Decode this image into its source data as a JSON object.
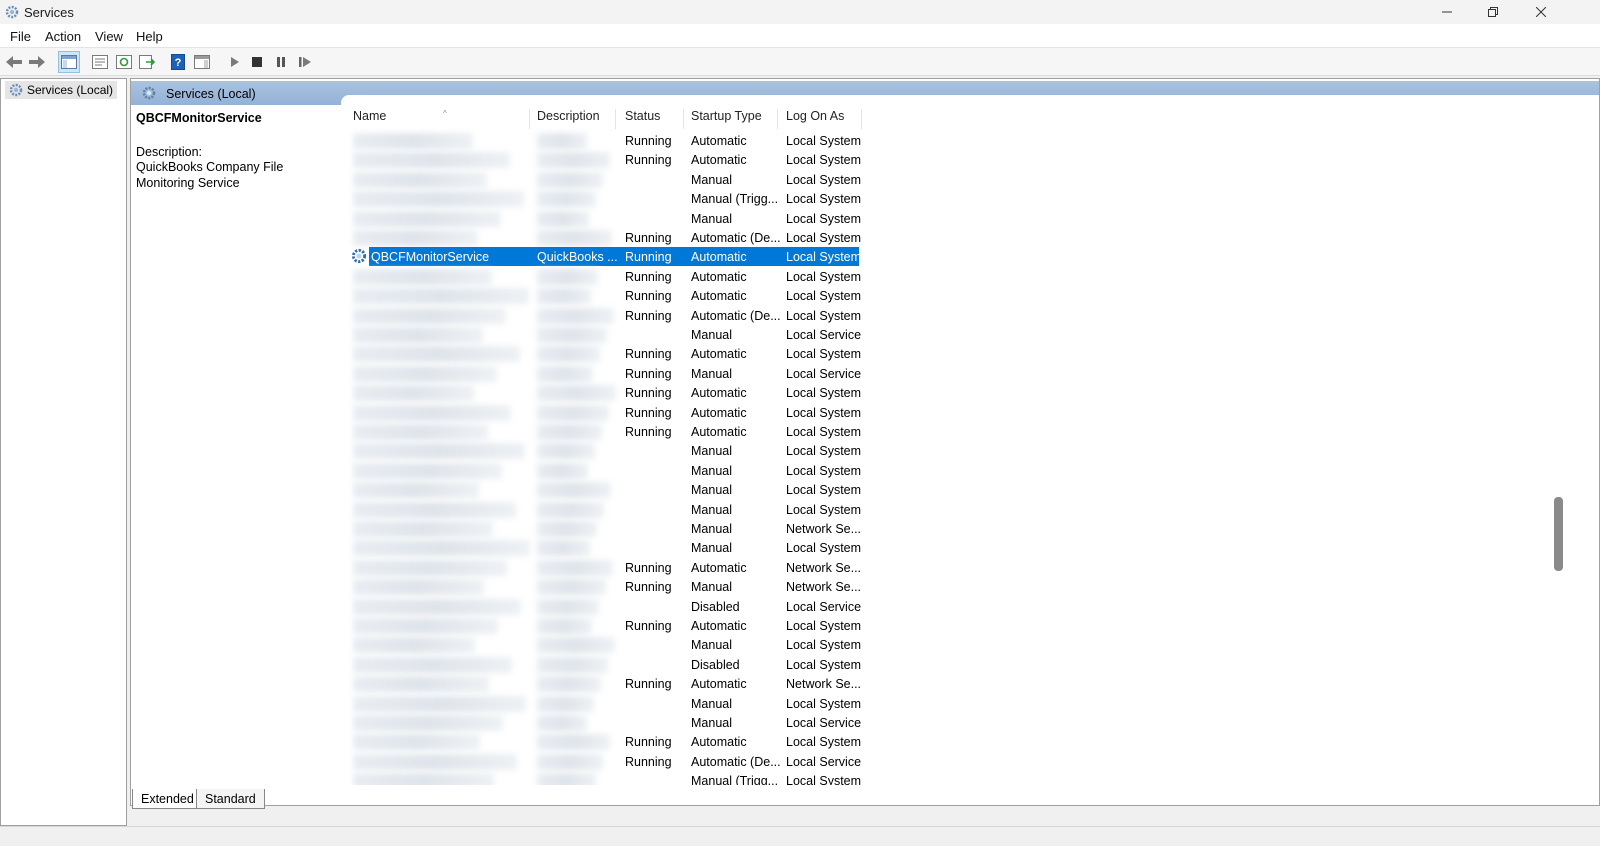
{
  "window": {
    "title": "Services"
  },
  "menu": {
    "items": [
      "File",
      "Action",
      "View",
      "Help"
    ]
  },
  "tree": {
    "root_label": "Services (Local)"
  },
  "header": {
    "title": "Services (Local)"
  },
  "description_pane": {
    "service_name": "QBCFMonitorService",
    "label": "Description:",
    "text": "QuickBooks Company File Monitoring Service"
  },
  "columns": [
    "Name",
    "Description",
    "Status",
    "Startup Type",
    "Log On As"
  ],
  "rows": [
    {
      "name": "",
      "description": "",
      "status": "Running",
      "startup": "Automatic",
      "logon": "Local System"
    },
    {
      "name": "",
      "description": "",
      "status": "Running",
      "startup": "Automatic",
      "logon": "Local System"
    },
    {
      "name": "",
      "description": "",
      "status": "",
      "startup": "Manual",
      "logon": "Local System"
    },
    {
      "name": "",
      "description": "",
      "status": "",
      "startup": "Manual (Trigg...",
      "logon": "Local System"
    },
    {
      "name": "",
      "description": "",
      "status": "",
      "startup": "Manual",
      "logon": "Local System"
    },
    {
      "name": "",
      "description": "",
      "status": "Running",
      "startup": "Automatic (De...",
      "logon": "Local System"
    },
    {
      "name": "QBCFMonitorService",
      "description": "QuickBooks ...",
      "status": "Running",
      "startup": "Automatic",
      "logon": "Local System",
      "selected": true
    },
    {
      "name": "",
      "description": "",
      "status": "Running",
      "startup": "Automatic",
      "logon": "Local System"
    },
    {
      "name": "",
      "description": "",
      "status": "Running",
      "startup": "Automatic",
      "logon": "Local System"
    },
    {
      "name": "",
      "description": "",
      "status": "Running",
      "startup": "Automatic (De...",
      "logon": "Local System"
    },
    {
      "name": "",
      "description": "",
      "status": "",
      "startup": "Manual",
      "logon": "Local Service"
    },
    {
      "name": "",
      "description": "",
      "status": "Running",
      "startup": "Automatic",
      "logon": "Local System"
    },
    {
      "name": "",
      "description": "",
      "status": "Running",
      "startup": "Manual",
      "logon": "Local Service"
    },
    {
      "name": "",
      "description": "",
      "status": "Running",
      "startup": "Automatic",
      "logon": "Local System"
    },
    {
      "name": "",
      "description": "",
      "status": "Running",
      "startup": "Automatic",
      "logon": "Local System"
    },
    {
      "name": "",
      "description": "",
      "status": "Running",
      "startup": "Automatic",
      "logon": "Local System"
    },
    {
      "name": "",
      "description": "",
      "status": "",
      "startup": "Manual",
      "logon": "Local System"
    },
    {
      "name": "",
      "description": "",
      "status": "",
      "startup": "Manual",
      "logon": "Local System"
    },
    {
      "name": "",
      "description": "",
      "status": "",
      "startup": "Manual",
      "logon": "Local System"
    },
    {
      "name": "",
      "description": "",
      "status": "",
      "startup": "Manual",
      "logon": "Local System"
    },
    {
      "name": "",
      "description": "",
      "status": "",
      "startup": "Manual",
      "logon": "Network Se..."
    },
    {
      "name": "",
      "description": "",
      "status": "",
      "startup": "Manual",
      "logon": "Local System"
    },
    {
      "name": "",
      "description": "",
      "status": "Running",
      "startup": "Automatic",
      "logon": "Network Se..."
    },
    {
      "name": "",
      "description": "",
      "status": "Running",
      "startup": "Manual",
      "logon": "Network Se..."
    },
    {
      "name": "",
      "description": "",
      "status": "",
      "startup": "Disabled",
      "logon": "Local Service"
    },
    {
      "name": "",
      "description": "",
      "status": "Running",
      "startup": "Automatic",
      "logon": "Local System"
    },
    {
      "name": "",
      "description": "",
      "status": "",
      "startup": "Manual",
      "logon": "Local System"
    },
    {
      "name": "",
      "description": "",
      "status": "",
      "startup": "Disabled",
      "logon": "Local System"
    },
    {
      "name": "",
      "description": "",
      "status": "Running",
      "startup": "Automatic",
      "logon": "Network Se..."
    },
    {
      "name": "",
      "description": "",
      "status": "",
      "startup": "Manual",
      "logon": "Local System"
    },
    {
      "name": "",
      "description": "",
      "status": "",
      "startup": "Manual",
      "logon": "Local Service"
    },
    {
      "name": "",
      "description": "",
      "status": "Running",
      "startup": "Automatic",
      "logon": "Local System"
    },
    {
      "name": "",
      "description": "",
      "status": "Running",
      "startup": "Automatic (De...",
      "logon": "Local Service"
    },
    {
      "name": "",
      "description": "",
      "status": "",
      "startup": "Manual (Trigg...",
      "logon": "Local System"
    }
  ],
  "tabs": [
    "Extended",
    "Standard"
  ],
  "icons": {
    "app": "services-gear-icon",
    "toolbar": [
      "back-arrow-icon",
      "forward-arrow-icon",
      "show-hide-console-tree-icon",
      "properties-icon",
      "refresh-icon",
      "export-list-icon",
      "help-icon",
      "show-hide-action-pane-icon",
      "start-service-icon",
      "stop-service-icon",
      "pause-service-icon",
      "resume-service-icon"
    ]
  },
  "colors": {
    "selection": "#0078d7",
    "header_band": "#94b2d6"
  }
}
